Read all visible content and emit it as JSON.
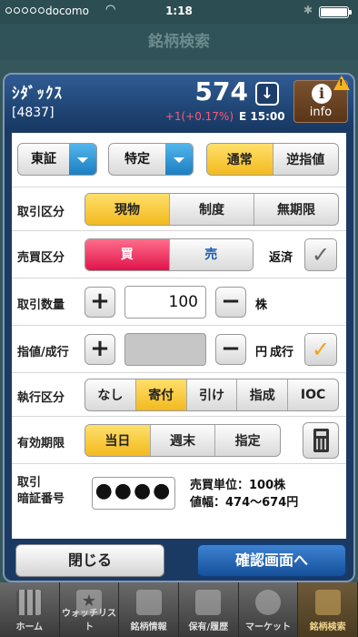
{
  "status_bar": {
    "carrier": "docomo",
    "time": "1:18"
  },
  "nav": {
    "title": "銘柄検索"
  },
  "stock": {
    "name": "ｼﾀﾞｯｸｽ",
    "code": "[4837]",
    "price": "574",
    "change": "+1(+0.17%)",
    "exchange_time": "E 15:00",
    "info_label": "info",
    "down_symbol": "↓",
    "info_symbol": "i"
  },
  "order": {
    "market_dropdown": "東証",
    "account_dropdown": "特定",
    "order_type": {
      "options": [
        "通常",
        "逆指値"
      ],
      "selected": 0
    },
    "trade_type": {
      "label": "取引区分",
      "options": [
        "現物",
        "制度",
        "無期限"
      ],
      "selected": 0
    },
    "side": {
      "label": "売買区分",
      "buy": "買",
      "sell": "売",
      "close_label": "返済",
      "close_checked": false
    },
    "quantity": {
      "label": "取引数量",
      "value": "100",
      "unit": "株",
      "plus": "+",
      "minus": "−"
    },
    "limit_price": {
      "label": "指値/成行",
      "value": "",
      "unit": "円",
      "market_label": "成行",
      "market_checked": true,
      "plus": "+",
      "minus": "−"
    },
    "execution": {
      "label": "執行区分",
      "options": [
        "なし",
        "寄付",
        "引け",
        "指成",
        "IOC"
      ],
      "selected": 1
    },
    "expiry": {
      "label": "有効期限",
      "options": [
        "当日",
        "週末",
        "指定"
      ],
      "selected": 0
    },
    "pin": {
      "label_line1": "取引",
      "label_line2": "暗証番号",
      "value": "●●●●"
    },
    "trade_unit": "売買単位：100株",
    "price_range": "値幅：474〜674円"
  },
  "buttons": {
    "close": "閉じる",
    "confirm": "確認画面へ"
  },
  "tabs": [
    {
      "label": "ホーム",
      "icon": "home-grid-icon"
    },
    {
      "label": "ウォッチリスト",
      "icon": "star-folder-icon"
    },
    {
      "label": "銘柄情報",
      "icon": "info-icon"
    },
    {
      "label": "保有/履歴",
      "icon": "clipboard-icon"
    },
    {
      "label": "マーケット",
      "icon": "globe-icon"
    },
    {
      "label": "銘柄検索",
      "icon": "search-icon"
    }
  ],
  "colors": {
    "accent_yellow": "#f3b91f",
    "buy_red": "#e0134b",
    "header_blue": "#1b3a63",
    "confirm_blue": "#15509b"
  }
}
